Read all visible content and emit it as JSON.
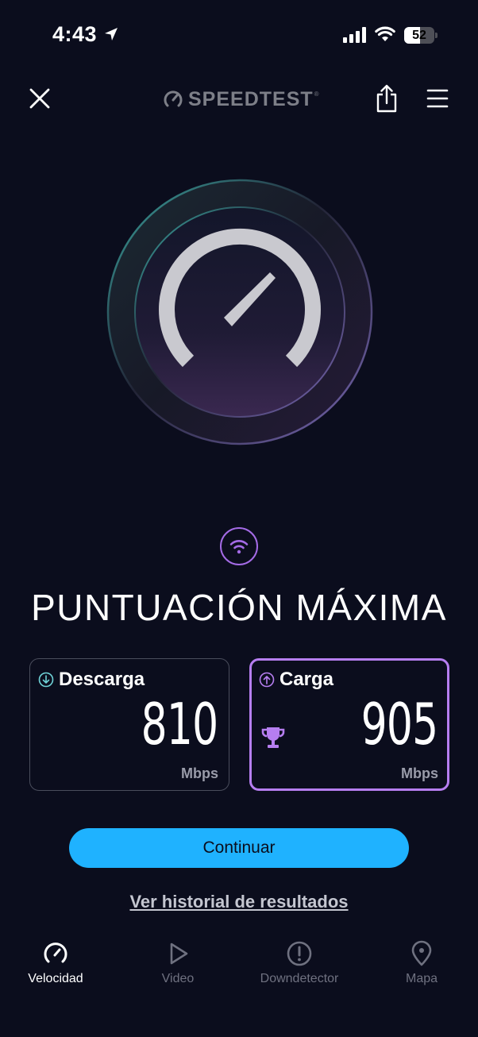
{
  "status_bar": {
    "time": "4:43",
    "battery_level": "52",
    "battery_fraction": 0.52
  },
  "header": {
    "logo_text": "SPEEDTEST",
    "logo_tm": "®",
    "icons": [
      "close-icon",
      "share-icon",
      "menu-icon"
    ]
  },
  "result": {
    "connection_icon": "wifi-icon",
    "title": "PUNTUACIÓN MÁXIMA",
    "download": {
      "label": "Descarga",
      "value": "810",
      "unit": "Mbps",
      "icon": "arrow-down-circle-icon"
    },
    "upload": {
      "label": "Carga",
      "value": "905",
      "unit": "Mbps",
      "icon": "arrow-up-circle-icon",
      "badge_icon": "trophy-icon"
    }
  },
  "actions": {
    "continue_label": "Continuar",
    "history_label": "Ver historial de resultados"
  },
  "tabs": [
    {
      "label": "Velocidad",
      "icon": "speedometer-icon",
      "active": true
    },
    {
      "label": "Video",
      "icon": "play-icon",
      "active": false
    },
    {
      "label": "Downdetector",
      "icon": "alert-icon",
      "active": false
    },
    {
      "label": "Mapa",
      "icon": "map-pin-icon",
      "active": false
    }
  ],
  "colors": {
    "background": "#0b0d1d",
    "accent_blue": "#1fb2ff",
    "accent_purple": "#b67ef0",
    "download_teal": "#6fd3d8"
  }
}
